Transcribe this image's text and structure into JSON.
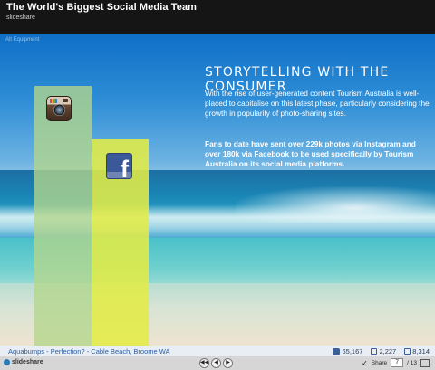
{
  "header": {
    "title": "The World's Biggest Social Media Team",
    "subtitle": "slideshare"
  },
  "slide": {
    "tag": "Alt Equipment",
    "heading": "STORYTELLING WITH THE CONSUMER",
    "paragraph": "With the rise of user-generated content Tourism Australia is well-placed to capitalise on this latest phase, particularly considering the growth in popularity of photo-sharing sites.",
    "highlight": "Fans to date have sent over 229k photos via Instagram and over 180k via Facebook to be used specifically by Tourism Australia on its social media platforms.",
    "bars": [
      {
        "name": "instagram",
        "value": 229,
        "color": "#b4d68c"
      },
      {
        "name": "facebook",
        "value": 180,
        "color": "#e2ec46"
      }
    ],
    "icons": {
      "bar1": "instagram-icon",
      "bar2": "facebook-icon"
    }
  },
  "caption": {
    "text": "Aquabumps - Perfection? - Cable Beach, Broome WA",
    "likes": "65,167",
    "comments": "2,227",
    "shares": "8,314"
  },
  "controls": {
    "brand": "slideshare",
    "page_current": "7",
    "page_total": "/ 13",
    "prev_label": "◀",
    "play_label": "▶",
    "next_label": "▶",
    "first_label": "◀◀",
    "share_label": "Share"
  },
  "colors": {
    "header_bg": "#151515",
    "bar_instagram": "#b4d68c",
    "bar_facebook": "#e2ec46",
    "caption_link": "#2d5fa0"
  }
}
